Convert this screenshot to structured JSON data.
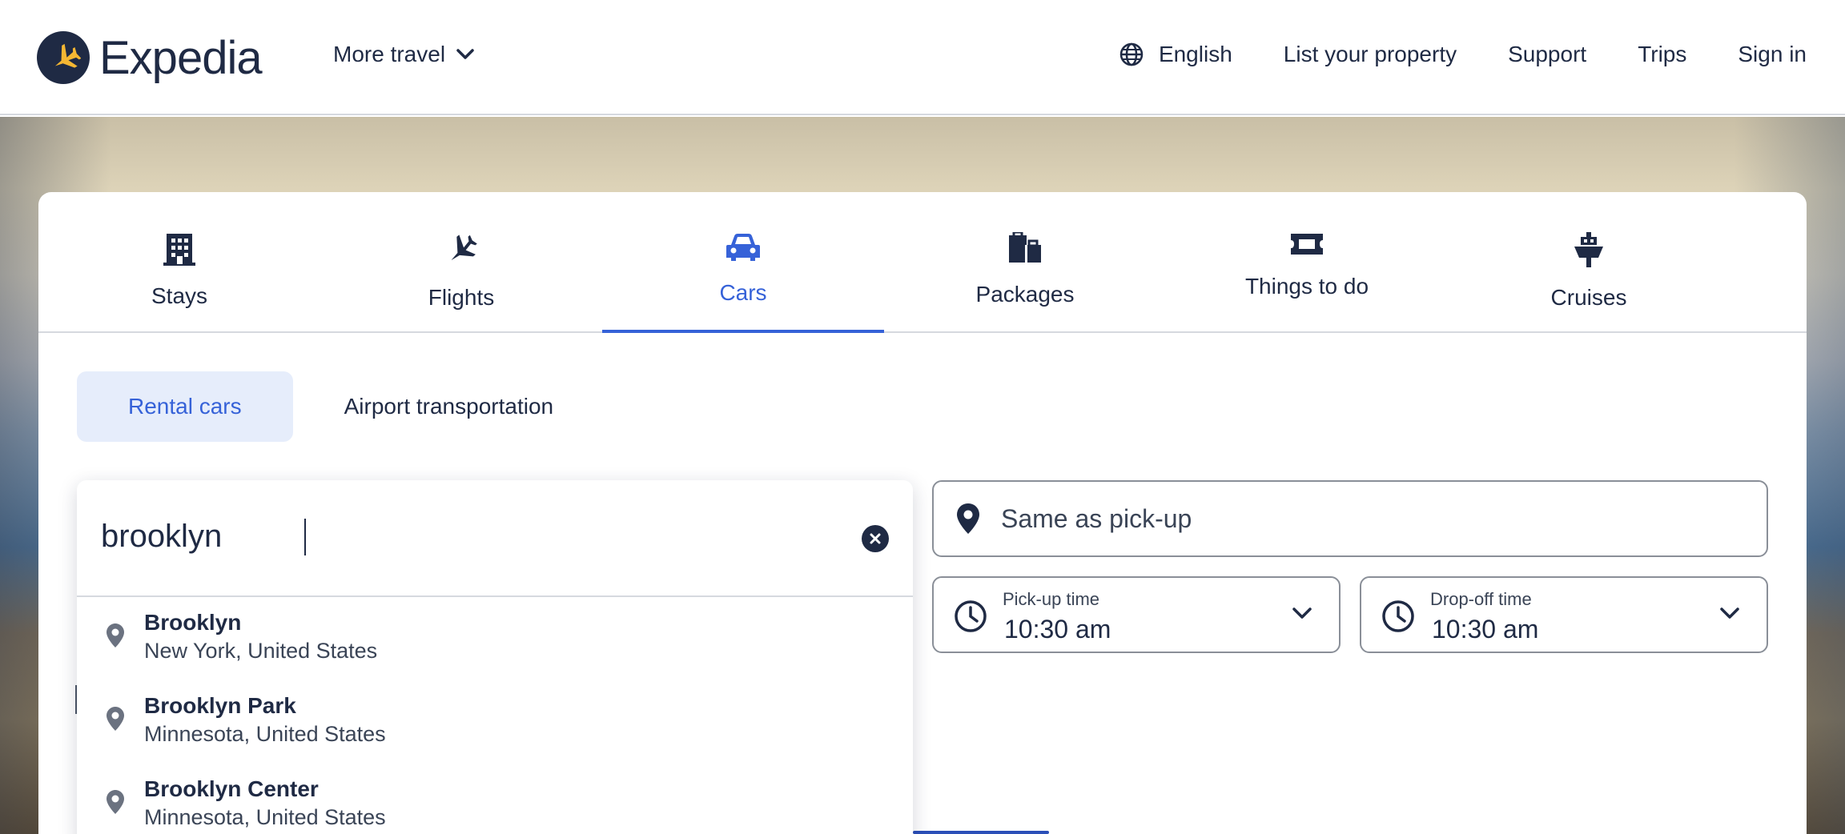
{
  "header": {
    "brand": "Expedia",
    "more_travel": "More travel",
    "nav": {
      "language": "English",
      "list_property": "List your property",
      "support": "Support",
      "trips": "Trips",
      "sign_in": "Sign in"
    }
  },
  "tabs": [
    {
      "label": "Stays",
      "icon": "building-icon"
    },
    {
      "label": "Flights",
      "icon": "plane-icon"
    },
    {
      "label": "Cars",
      "icon": "car-icon",
      "active": true
    },
    {
      "label": "Packages",
      "icon": "luggage-icon"
    },
    {
      "label": "Things to do",
      "icon": "ticket-icon"
    },
    {
      "label": "Cruises",
      "icon": "ship-icon"
    }
  ],
  "subtabs": {
    "rental_cars": "Rental cars",
    "airport_transportation": "Airport transportation",
    "active": "rental_cars"
  },
  "form": {
    "pickup_query": "brooklyn",
    "dropoff_placeholder": "Same as pick-up",
    "pickup_time_label": "Pick-up time",
    "pickup_time_value": "10:30 am",
    "dropoff_time_label": "Drop-off time",
    "dropoff_time_value": "10:30 am"
  },
  "suggestions": [
    {
      "title": "Brooklyn",
      "subtitle": "New York, United States"
    },
    {
      "title": "Brooklyn Park",
      "subtitle": "Minnesota, United States"
    },
    {
      "title": "Brooklyn Center",
      "subtitle": "Minnesota, United States"
    }
  ],
  "colors": {
    "accent": "#3662d8",
    "text": "#1f2a44",
    "active_subtab_bg": "#e6edfb",
    "logo_gold": "#f5b733"
  }
}
